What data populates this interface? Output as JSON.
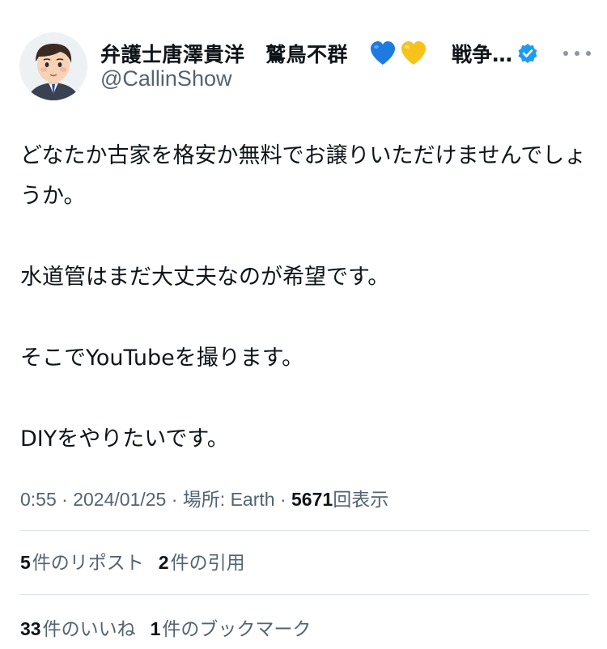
{
  "author": {
    "display_name": "弁護士唐澤貴洋　鷲鳥不群",
    "hearts": [
      "blue-heart",
      "yellow-heart"
    ],
    "name_suffix": "戦争…",
    "handle": "@CallinShow",
    "verified": true
  },
  "tweet": {
    "paragraphs": [
      "どなたか古家を格安か無料でお譲りいただけませんでしょうか。",
      "水道管はまだ大丈夫なのが希望です。",
      "そこでYouTubeを撮ります。",
      "DIYをやりたいです。"
    ]
  },
  "meta": {
    "time": "0:55",
    "separator": "·",
    "date": "2024/01/25",
    "location": "場所: Earth",
    "views_count": "5671",
    "views_label": "回表示"
  },
  "stats_row1": [
    {
      "count": "5",
      "label": "件のリポスト"
    },
    {
      "count": "2",
      "label": "件の引用"
    }
  ],
  "stats_row2": [
    {
      "count": "33",
      "label": "件のいいね"
    },
    {
      "count": "1",
      "label": "件のブックマーク"
    }
  ],
  "colors": {
    "text": "#0f1419",
    "secondary": "#536471",
    "verified": "#1d9bf0",
    "divider": "#dde3e8"
  }
}
